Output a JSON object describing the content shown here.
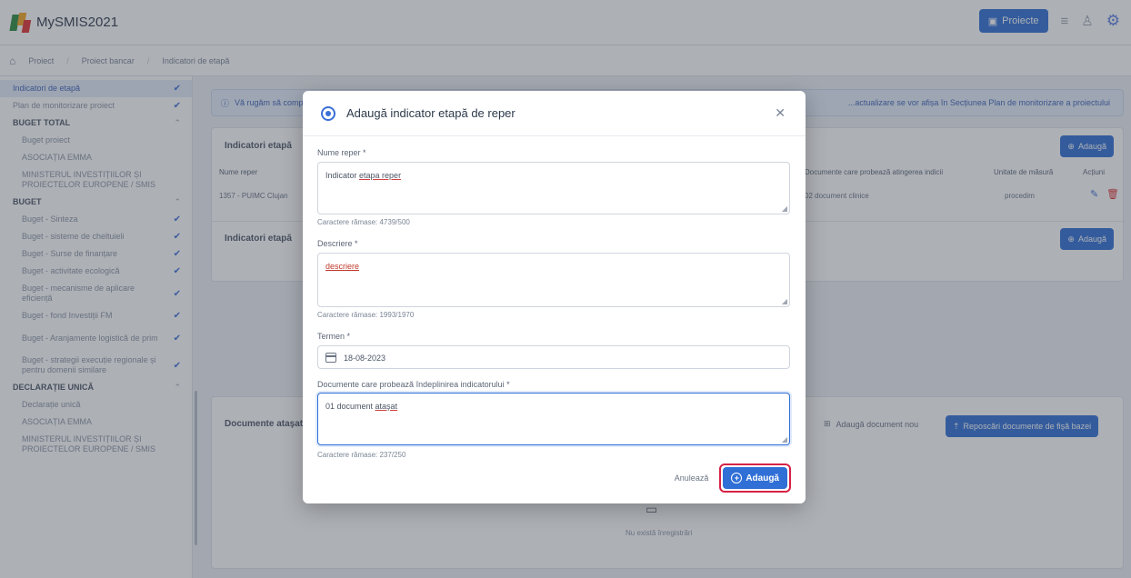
{
  "app": {
    "title": "MySMIS2021"
  },
  "topbar": {
    "projects_label": "Proiecte"
  },
  "breadcrumb": {
    "items": [
      "Proiect",
      "Proiect bancar",
      "Indicatori de etapă"
    ]
  },
  "sidebar": {
    "items": [
      {
        "label": "Indicatori de etapă",
        "type": "item",
        "checked": true,
        "active": true
      },
      {
        "label": "Plan de monitorizare proiect",
        "type": "item",
        "checked": true
      },
      {
        "label": "BUGET TOTAL",
        "type": "section"
      },
      {
        "label": "Buget proiect",
        "type": "sub"
      },
      {
        "label": "ASOCIAȚIA EMMA",
        "type": "sub"
      },
      {
        "label": "MINISTERUL INVESTIȚIILOR ȘI PROIECTELOR EUROPENE / SMIS",
        "type": "sub-tall"
      },
      {
        "label": "BUGET",
        "type": "section"
      },
      {
        "label": "Buget - Sinteza",
        "type": "sub",
        "checked": true
      },
      {
        "label": "Buget - sisteme de cheltuieli",
        "type": "sub",
        "checked": true
      },
      {
        "label": "Buget - Surse de finanțare",
        "type": "sub",
        "checked": true
      },
      {
        "label": "Buget - activitate ecologică",
        "type": "sub",
        "checked": true
      },
      {
        "label": "Buget - mecanisme de aplicare eficiență",
        "type": "sub-tall",
        "checked": true
      },
      {
        "label": "Buget - fond Investiții FM",
        "type": "sub",
        "checked": true
      },
      {
        "label": "Buget - Aranjamente logistică de prim",
        "type": "sub-tall",
        "checked": true
      },
      {
        "label": "Buget - strategii execuție regionale și pentru domenii similare",
        "type": "sub-tall",
        "checked": true
      },
      {
        "label": "DECLARAȚIE UNICĂ",
        "type": "section"
      },
      {
        "label": "Declarație unică",
        "type": "sub"
      },
      {
        "label": "ASOCIAȚIA EMMA",
        "type": "sub"
      },
      {
        "label": "MINISTERUL INVESTIȚIILOR ȘI PROIECTELOR EUROPENE / SMIS",
        "type": "sub-tall"
      }
    ]
  },
  "main": {
    "info_text": "Vă rugăm să completați...",
    "info_right": "...actualizare se vor afișa în Secțiunea Plan de monitorizare a proiectului",
    "card1_title": "Indicatori etapă",
    "card1b_title": "Indicatori etapă",
    "add_label": "Adaugă",
    "table_headers": [
      "Nume reper",
      "Documente care probează atingerea indicii",
      "Unitate de măsură",
      "Acțiuni"
    ],
    "row": {
      "name": "1357 - PUIMC Clujan",
      "doc": "02 document clinice",
      "unit": "procedim"
    },
    "docs_title": "Documente ataşate",
    "add_doc_label": "Adaugă document nou",
    "upload_label": "Reposcări documente de fişă bazei",
    "empty_text": "Nu există înregistrări"
  },
  "modal": {
    "title": "Adaugă indicator etapă de reper",
    "fields": {
      "name_label": "Nume reper *",
      "name_value_plain": "Indicator ",
      "name_value_underlined": "etapa reper",
      "name_counter": "Caractere rămase: 4739/500",
      "desc_label": "Descriere *",
      "desc_value": "descriere",
      "desc_counter": "Caractere rămase: 1993/1970",
      "deadline_label": "Termen *",
      "deadline_value": "18-08-2023",
      "docs_label": "Documente care probează îndeplinirea indicatorului *",
      "docs_value_plain": "01 document ",
      "docs_value_underlined": "ataşat",
      "docs_counter": "Caractere rămase: 237/250"
    },
    "cancel_label": "Anulează",
    "submit_label": "Adaugă"
  },
  "colors": {
    "primary": "#2f6fd6",
    "highlight": "#d62246"
  }
}
